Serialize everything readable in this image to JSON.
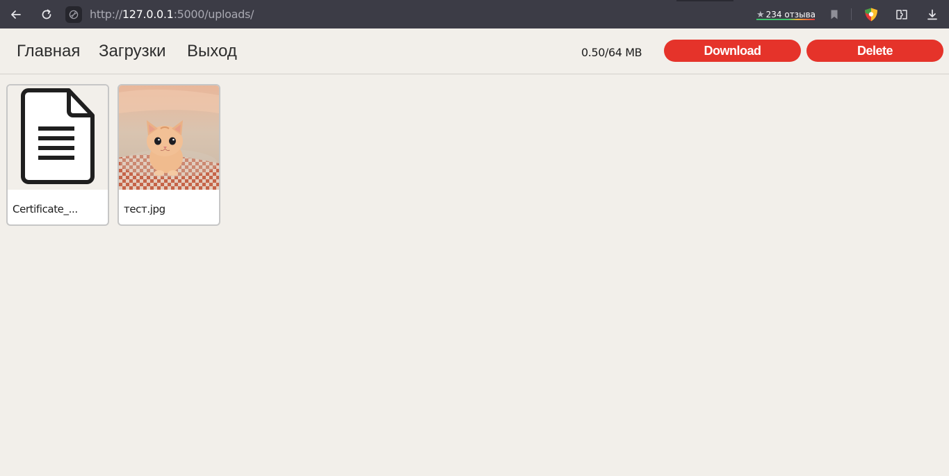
{
  "browser": {
    "url_scheme": "http://",
    "url_host": "127.0.0.1",
    "url_path": ":5000/uploads/",
    "reviews_label": "234 отзыва",
    "icons": [
      "back-icon",
      "reload-icon",
      "site-info-icon",
      "star-icon",
      "bookmark-icon",
      "shield-extension-icon",
      "extensions-icon",
      "download-icon"
    ]
  },
  "nav": {
    "home": "Главная",
    "uploads": "Загрузки",
    "logout": "Выход"
  },
  "quota": {
    "label": "0.50/64 MB"
  },
  "actions": {
    "download": "Download",
    "delete": "Delete"
  },
  "files": [
    {
      "name": "Certificate_...",
      "type": "document",
      "icon": "document-icon"
    },
    {
      "name": "тест.jpg",
      "type": "image",
      "description": "kitten photo"
    }
  ],
  "colors": {
    "accent": "#e5332a",
    "background": "#f2efea",
    "browser_bar": "#3c3c46"
  }
}
